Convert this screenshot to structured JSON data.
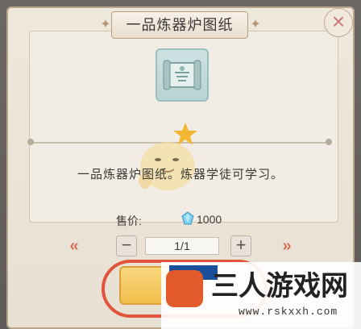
{
  "dialog": {
    "title": "一品炼器炉图纸",
    "description": "一品炼器炉图纸。炼器学徒可学习。",
    "item_icon": "scroll-blueprint-icon"
  },
  "purchase": {
    "price_label": "售价:",
    "price_value": "1000",
    "currency_icon": "blue-crystal-icon",
    "quantity": "1/1",
    "decrease_label": "−",
    "increase_label": "+"
  },
  "watermark": {
    "text": "三人游戏网",
    "url": "www.rskxxh.com"
  },
  "colors": {
    "accent": "#e1543c",
    "button": "#f1bd4a",
    "panel": "#efe8dc"
  }
}
